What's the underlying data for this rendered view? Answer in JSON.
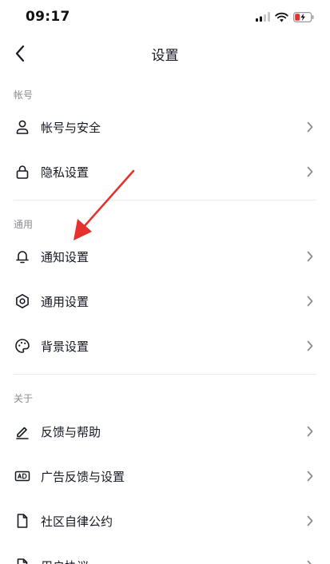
{
  "status_bar": {
    "time": "09:17"
  },
  "header": {
    "title": "设置"
  },
  "sections": [
    {
      "title": "帐号",
      "items": [
        {
          "label": "帐号与安全",
          "icon": "user-icon"
        },
        {
          "label": "隐私设置",
          "icon": "lock-icon"
        }
      ]
    },
    {
      "title": "通用",
      "items": [
        {
          "label": "通知设置",
          "icon": "bell-icon"
        },
        {
          "label": "通用设置",
          "icon": "gear-icon"
        },
        {
          "label": "背景设置",
          "icon": "palette-icon"
        }
      ]
    },
    {
      "title": "关于",
      "items": [
        {
          "label": "反馈与帮助",
          "icon": "pen-icon"
        },
        {
          "label": "广告反馈与设置",
          "icon": "ad-icon"
        },
        {
          "label": "社区自律公约",
          "icon": "document-icon"
        },
        {
          "label": "用户协议",
          "icon": "document-icon"
        }
      ]
    }
  ],
  "colors": {
    "arrow": "#e5322d",
    "divider": "#ececec",
    "section_header": "#8a8b91"
  }
}
